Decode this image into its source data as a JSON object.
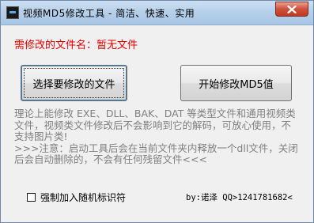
{
  "window": {
    "title": "视频MD5修改工具 - 简洁、快速、实用"
  },
  "main": {
    "filename_label": "需修改的文件名：暂无文件",
    "select_button": "选择要修改的文件",
    "start_button": "开始修改MD5值",
    "info_text": "理论上能修改 EXE、DLL、BAK、DAT 等类型文件和通用视频类文件，视频类文件修改后不会影响到它的解码，可放心使用，不支持图片类!\n>>>注意：启动工具后会在当前文件夹内释放一个dll文件，关闭后会自动删除的，不会有任何残留文件<<<",
    "checkbox_label": "强制加入随机标识符",
    "checkbox_checked": false,
    "author": "by:诺泽 QQ>1241781682<"
  },
  "colors": {
    "warning": "#e10000",
    "info_text": "#7f7f7f"
  }
}
